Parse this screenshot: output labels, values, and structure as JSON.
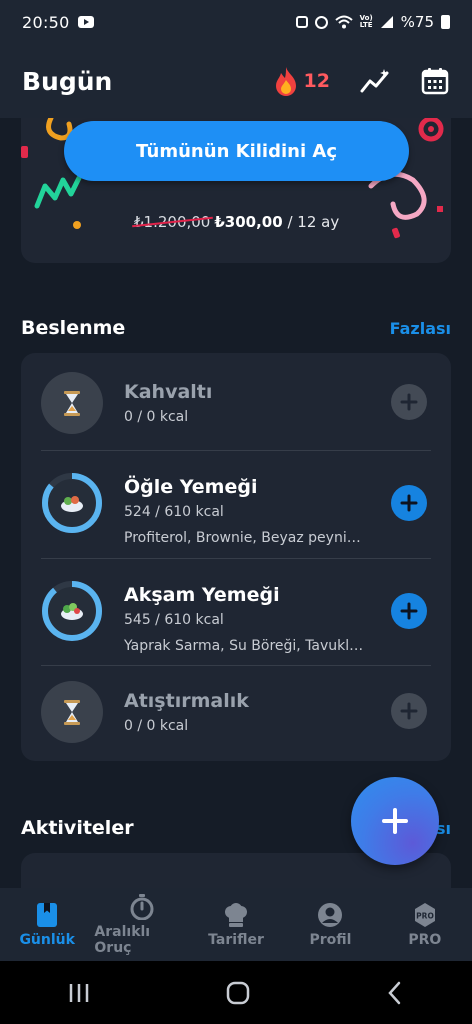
{
  "status_bar": {
    "time": "20:50",
    "battery": "%75",
    "network": "LTE"
  },
  "header": {
    "title": "Bugün",
    "streak_count": "12"
  },
  "promo": {
    "unlock_label": "Tümünün Kilidini Aç",
    "old_price": "₺1.200,00",
    "new_price": "₺300,00",
    "period": "/ 12 ay"
  },
  "nutrition": {
    "title": "Beslenme",
    "more_label": "Fazlası",
    "meals": [
      {
        "name": "Kahvaltı",
        "kcal": "0 / 0 kcal",
        "items": "",
        "progress": 0
      },
      {
        "name": "Öğle Yemeği",
        "kcal": "524 / 610 kcal",
        "items": "Profiterol, Brownie, Beyaz peyni…",
        "progress": 0.86
      },
      {
        "name": "Akşam Yemeği",
        "kcal": "545 / 610 kcal",
        "items": "Yaprak Sarma, Su Böreği, Tavukl…",
        "progress": 0.89
      },
      {
        "name": "Atıştırmalık",
        "kcal": "0 / 0 kcal",
        "items": "",
        "progress": 0
      }
    ]
  },
  "activities": {
    "title": "Aktiviteler",
    "more_label": "Fazlası"
  },
  "bottom_nav": [
    {
      "label": "Günlük",
      "icon": "diary-icon",
      "active": true
    },
    {
      "label": "Aralıklı Oruç",
      "icon": "stopwatch-icon",
      "active": false
    },
    {
      "label": "Tarifler",
      "icon": "chef-hat-icon",
      "active": false
    },
    {
      "label": "Profil",
      "icon": "profile-icon",
      "active": false
    },
    {
      "label": "PRO",
      "icon": "pro-badge-icon",
      "active": false
    }
  ],
  "colors": {
    "accent": "#1a8fe8",
    "streak": "#ff5a5f",
    "background": "#151c27",
    "card": "#1f2633"
  }
}
